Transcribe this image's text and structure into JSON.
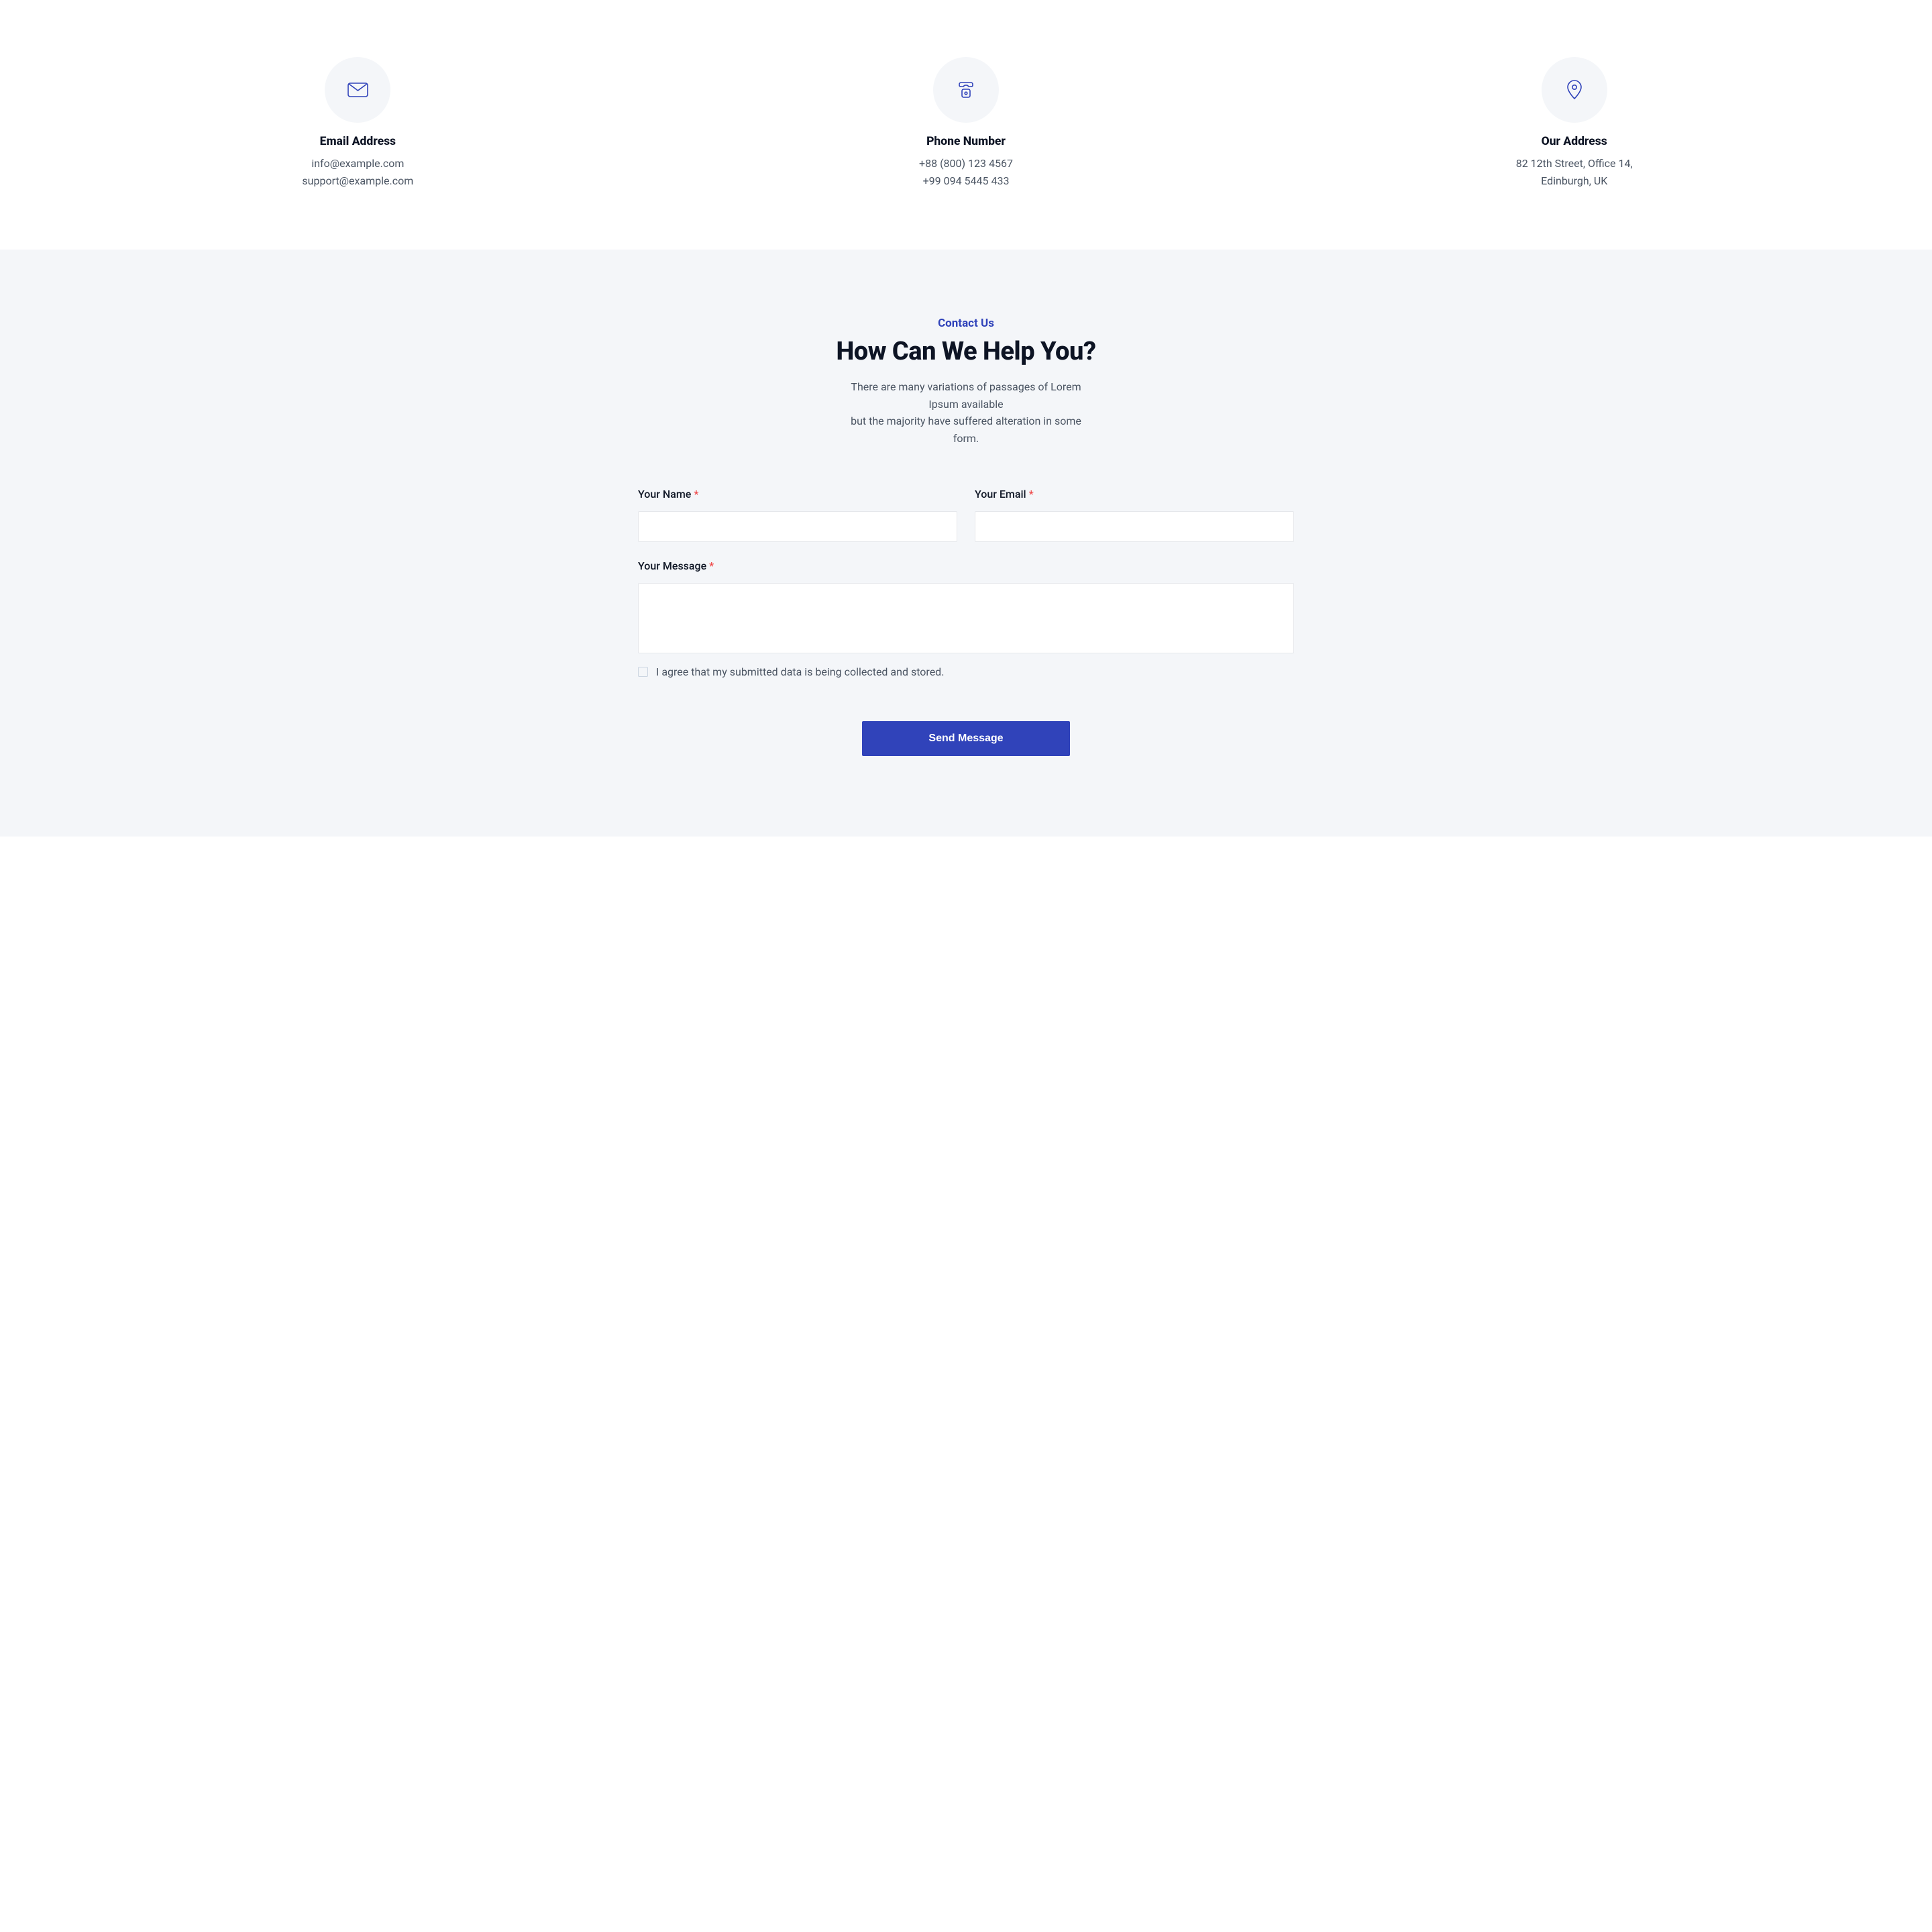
{
  "info": {
    "email": {
      "title": "Email Address",
      "line1": "info@example.com",
      "line2": "support@example.com"
    },
    "phone": {
      "title": "Phone Number",
      "line1": "+88 (800) 123 4567",
      "line2": "+99 094 5445 433"
    },
    "address": {
      "title": "Our Address",
      "line1": "82 12th Street, Office 14,",
      "line2": "Edinburgh, UK"
    }
  },
  "form": {
    "eyebrow": "Contact Us",
    "title": "How Can We Help You?",
    "subtitle1": "There are many variations of passages of Lorem Ipsum available",
    "subtitle2": "but the majority have suffered alteration in some form.",
    "name_label": "Your Name",
    "email_label": "Your Email",
    "message_label": "Your Message",
    "required_mark": "*",
    "name_value": "",
    "email_value": "",
    "message_value": "",
    "checkbox_label": "I agree that my submitted data is being collected and stored.",
    "submit_label": "Send Message"
  }
}
